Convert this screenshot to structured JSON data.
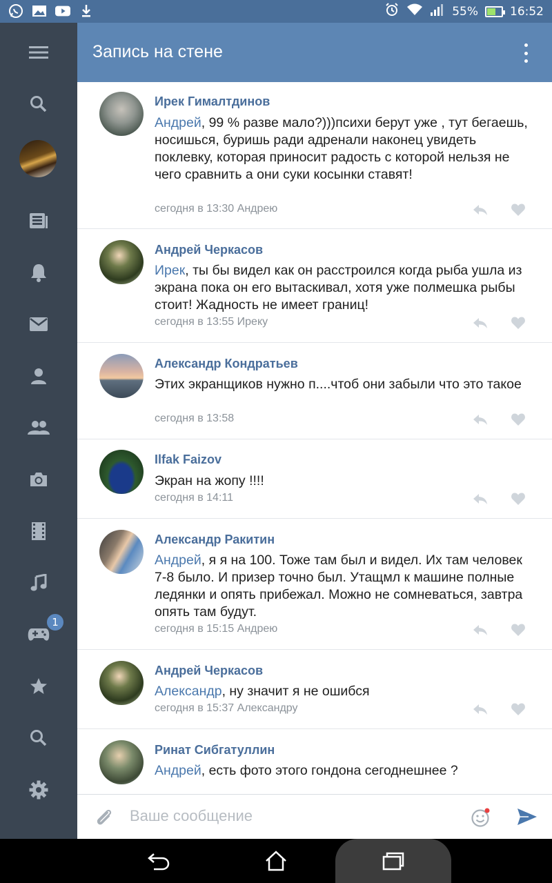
{
  "status_bar": {
    "icons_left": [
      "whatsapp-icon",
      "gallery-icon",
      "youtube-icon",
      "download-icon"
    ],
    "battery_percent": "55%",
    "battery_level": 0.55,
    "time": "16:52"
  },
  "header": {
    "title": "Запись на стене"
  },
  "sidebar": {
    "items": [
      "menu-icon",
      "search-icon",
      "avatar",
      "news-icon",
      "notifications-icon",
      "messages-icon",
      "profile-icon",
      "friends-icon",
      "photos-icon",
      "videos-icon",
      "music-icon",
      "games-icon",
      "favorites-icon",
      "search-icon",
      "settings-icon"
    ],
    "games_badge": "1"
  },
  "comments": [
    {
      "author": "Ирек Гималтдинов",
      "mention": "Андрей",
      "text": ", 99 % разве мало?)))психи берут уже , тут бегаешь, носишься, буришь ради адренали наконец увидеть поклевку, которая приносит радость с которой нельзя не чего сравнить а они суки косынки ставят!",
      "meta": "сегодня в 13:30 Андрею"
    },
    {
      "author": "Андрей Черкасов",
      "mention": "Ирек",
      "text": ", ты бы видел как он расстроился когда рыба ушла из экрана пока он его вытаскивал, хотя уже полмешка рыбы стоит! Жадность не имеет границ!",
      "meta": "сегодня в 13:55 Иреку"
    },
    {
      "author": "Александр Кондратьев",
      "mention": "",
      "text": "Этих экранщиков нужно п....чтоб они забыли что это такое",
      "meta": "сегодня в 13:58"
    },
    {
      "author": "Ilfak Faizov",
      "mention": "",
      "text": "Экран на жопу !!!!",
      "meta": "сегодня в 14:11"
    },
    {
      "author": "Александр Ракитин",
      "mention": "Андрей",
      "text": ", я я на 100. Тоже там был и видел. Их там человек 7-8 было. И призер точно был. Утащмл к машине полные ледянки и опять прибежал. Можно не сомневаться, завтра опять там будут.",
      "meta": "сегодня в 15:15 Андрею"
    },
    {
      "author": "Андрей Черкасов",
      "mention": "Александр",
      "text": ", ну значит я не ошибся",
      "meta": "сегодня в 15:37 Александру"
    },
    {
      "author": "Ринат Сибгатуллин",
      "mention": "Андрей",
      "text": ", есть фото этого гондона сегоднешнее ?",
      "meta": ""
    }
  ],
  "compose": {
    "placeholder": "Ваше сообщение"
  },
  "colors": {
    "status_bar": "#4a6f9a",
    "header": "#5d86b4",
    "sidebar": "#3a4552",
    "author": "#4a6e9b",
    "mention": "#4a78ad",
    "meta": "#8b9299"
  }
}
